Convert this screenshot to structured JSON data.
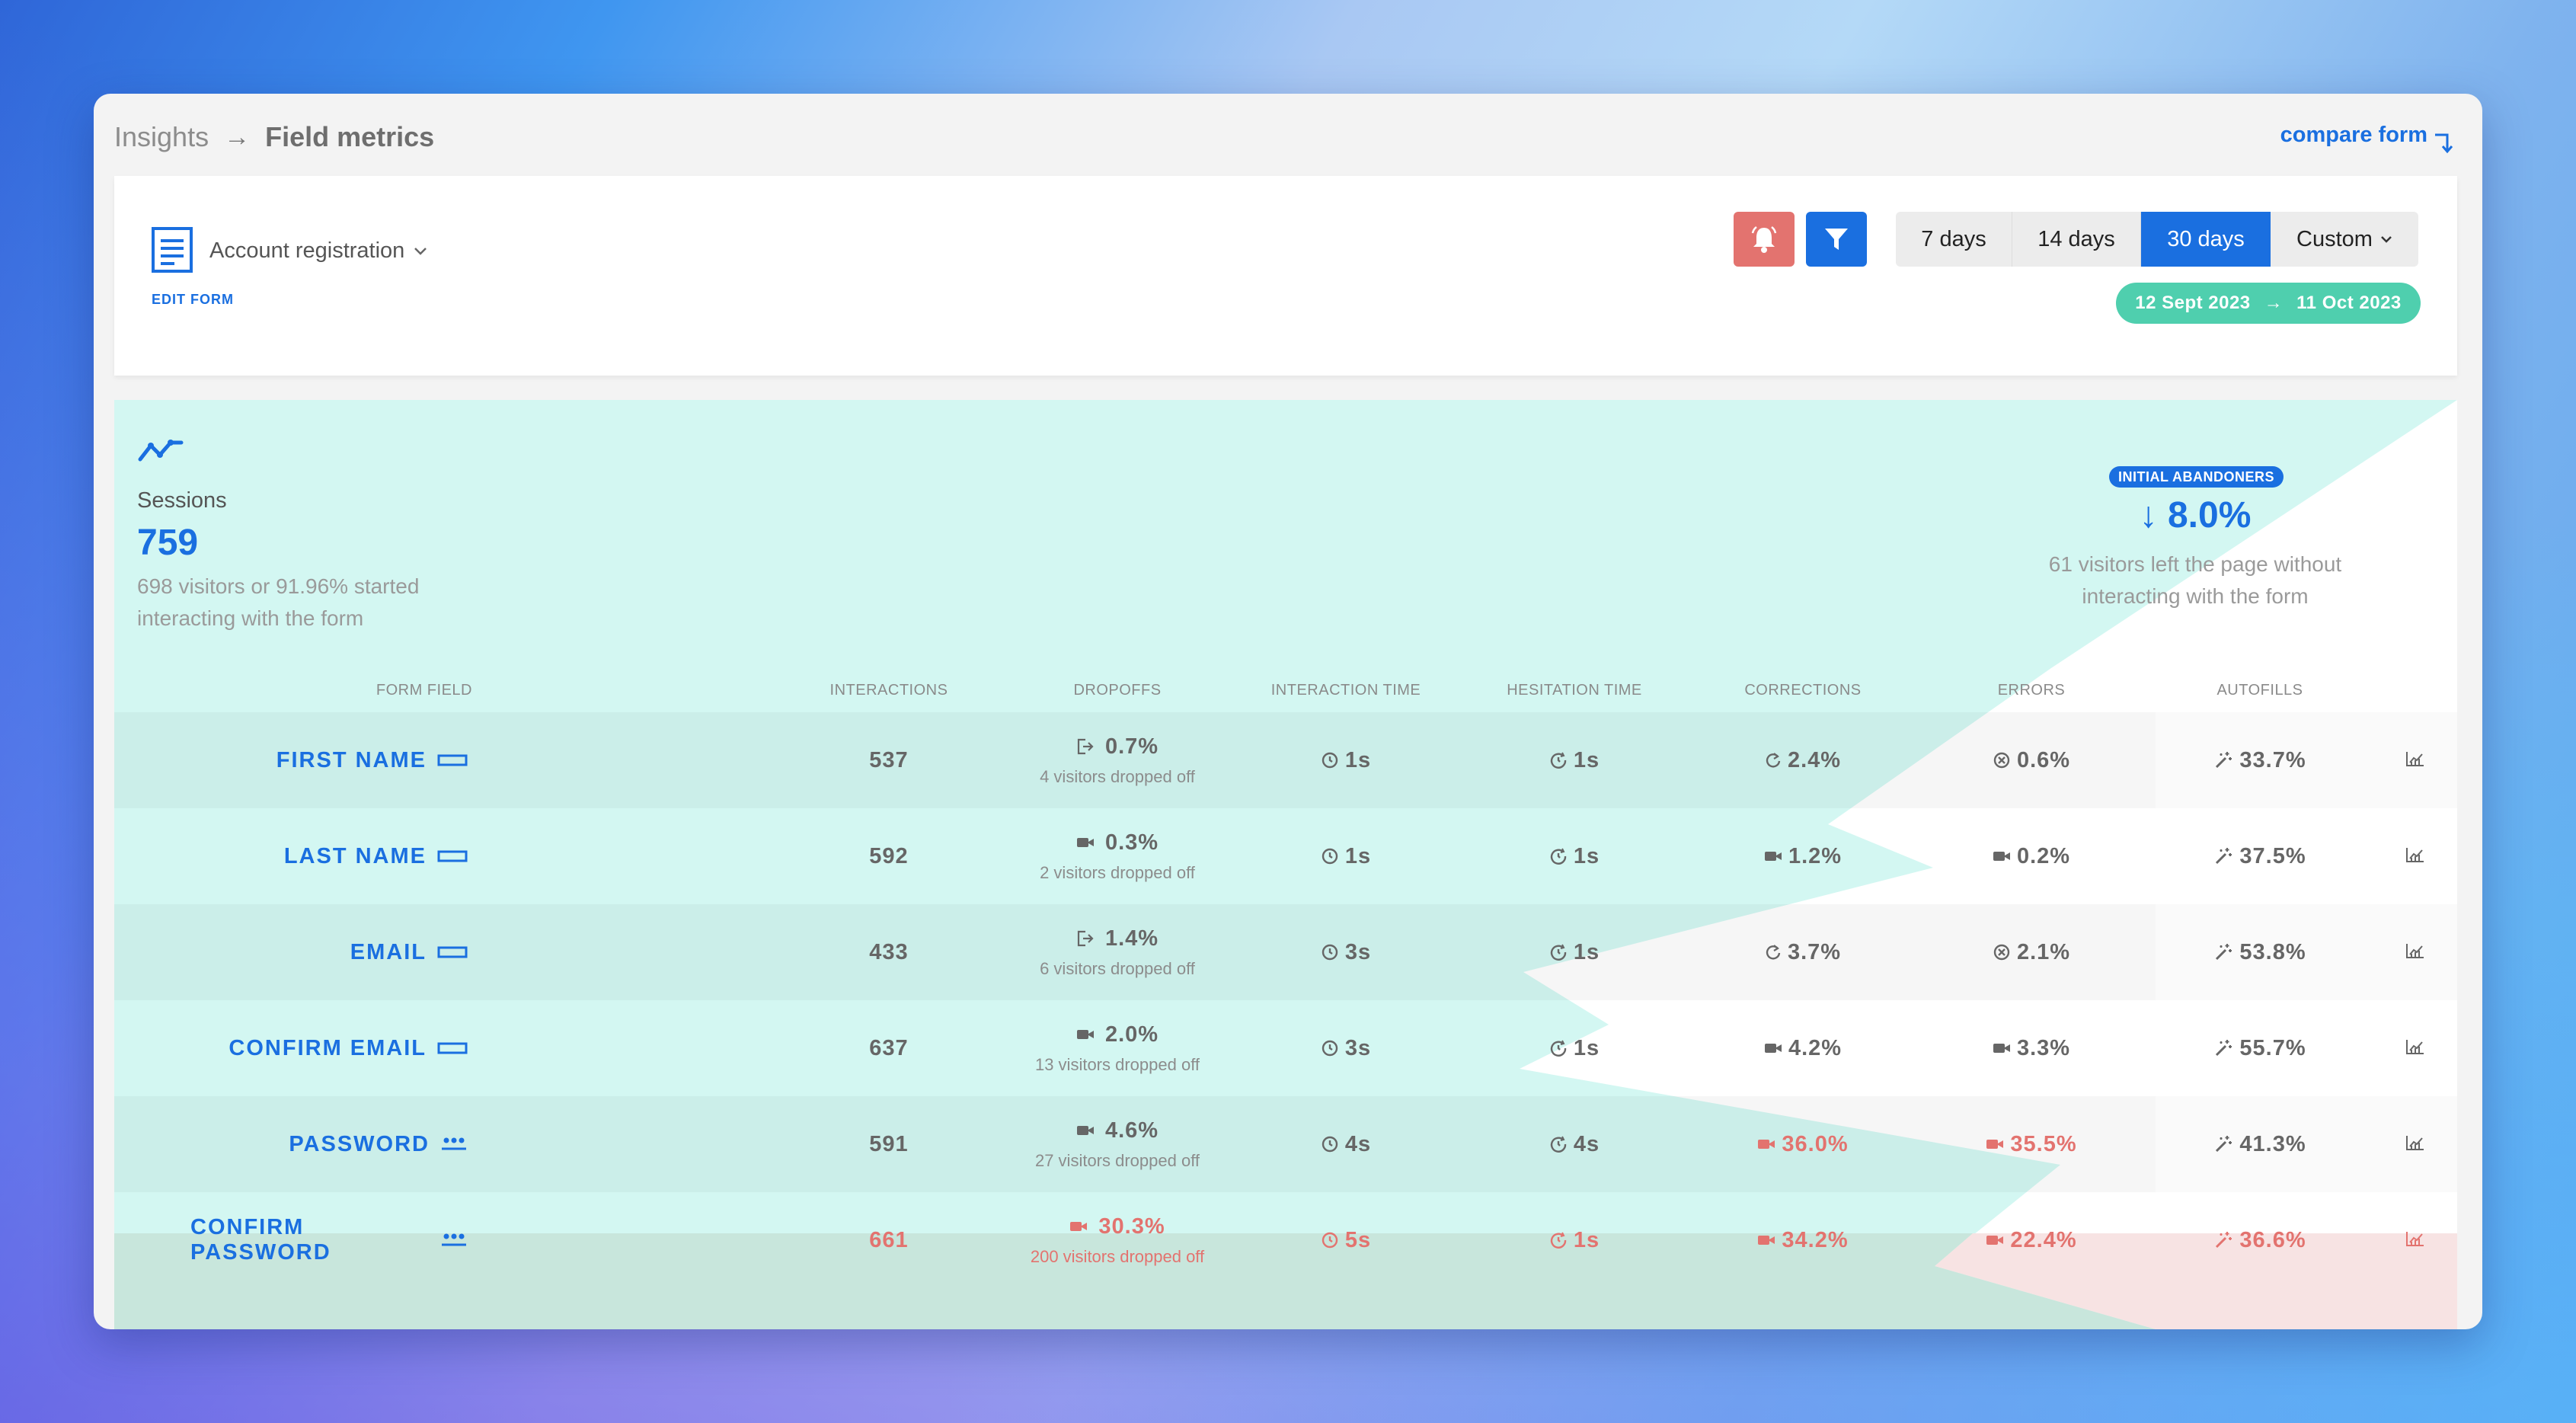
{
  "breadcrumb": {
    "root": "Insights",
    "current": "Field metrics"
  },
  "compare_link": "compare form",
  "form": {
    "name": "Account registration",
    "edit_label": "EDIT FORM"
  },
  "ranges": {
    "r7": "7 days",
    "r14": "14 days",
    "r30": "30 days",
    "custom": "Custom",
    "selected": "30 days"
  },
  "date_range": {
    "start": "12 Sept 2023",
    "end": "11 Oct 2023"
  },
  "sessions": {
    "label": "Sessions",
    "value": "759",
    "sub": "698 visitors or 91.96% started interacting with the form"
  },
  "abandoners": {
    "badge": "INITIAL ABANDONERS",
    "value": "↓ 8.0%",
    "sub": "61 visitors left the page without interacting with the form"
  },
  "columns": {
    "field": "FORM FIELD",
    "interactions": "INTERACTIONS",
    "dropoffs": "DROPOFFS",
    "interaction_time": "INTERACTION TIME",
    "hesitation_time": "HESITATION TIME",
    "corrections": "CORRECTIONS",
    "errors": "ERRORS",
    "autofills": "AUTOFILLS"
  },
  "colors": {
    "accent": "#1a6fe0",
    "danger": "#e3736f",
    "teal": "#4fcfae",
    "mint": "#d3f7f2"
  },
  "rows": [
    {
      "name": "FIRST NAME",
      "icon": "text-field-icon",
      "interactions": "537",
      "dropoff": "0.7%",
      "dropoff_icon": "exit-icon",
      "dropoff_sub": "4 visitors dropped off",
      "itime": "1s",
      "htime": "1s",
      "corrections": "2.4%",
      "corr_icon": "refresh-icon",
      "errors": "0.6%",
      "err_icon": "x-circle-icon",
      "autofills": "33.7%"
    },
    {
      "name": "LAST NAME",
      "icon": "text-field-icon",
      "interactions": "592",
      "dropoff": "0.3%",
      "dropoff_icon": "video-icon",
      "dropoff_sub": "2 visitors dropped off",
      "itime": "1s",
      "htime": "1s",
      "corrections": "1.2%",
      "corr_icon": "video-icon",
      "errors": "0.2%",
      "err_icon": "video-icon",
      "autofills": "37.5%"
    },
    {
      "name": "EMAIL",
      "icon": "text-field-icon",
      "interactions": "433",
      "dropoff": "1.4%",
      "dropoff_icon": "exit-icon",
      "dropoff_sub": "6 visitors dropped off",
      "itime": "3s",
      "htime": "1s",
      "corrections": "3.7%",
      "corr_icon": "refresh-icon",
      "errors": "2.1%",
      "err_icon": "x-circle-icon",
      "autofills": "53.8%"
    },
    {
      "name": "CONFIRM EMAIL",
      "icon": "text-field-icon",
      "interactions": "637",
      "dropoff": "2.0%",
      "dropoff_icon": "video-icon",
      "dropoff_sub": "13 visitors dropped off",
      "itime": "3s",
      "htime": "1s",
      "corrections": "4.2%",
      "corr_icon": "video-icon",
      "errors": "3.3%",
      "err_icon": "video-icon",
      "autofills": "55.7%"
    },
    {
      "name": "PASSWORD",
      "icon": "password-icon",
      "interactions": "591",
      "dropoff": "4.6%",
      "dropoff_icon": "video-icon",
      "dropoff_sub": "27 visitors dropped off",
      "itime": "4s",
      "htime": "4s",
      "corrections": "36.0%",
      "corr_icon": "video-icon",
      "errors": "35.5%",
      "err_icon": "video-icon",
      "autofills": "41.3%"
    },
    {
      "name": "CONFIRM PASSWORD",
      "icon": "password-icon",
      "interactions": "661",
      "dropoff": "30.3%",
      "dropoff_icon": "video-icon",
      "dropoff_sub": "200 visitors dropped off",
      "itime": "5s",
      "htime": "1s",
      "corrections": "34.2%",
      "corr_icon": "video-icon",
      "errors": "22.4%",
      "err_icon": "video-icon",
      "autofills": "36.6%"
    }
  ]
}
